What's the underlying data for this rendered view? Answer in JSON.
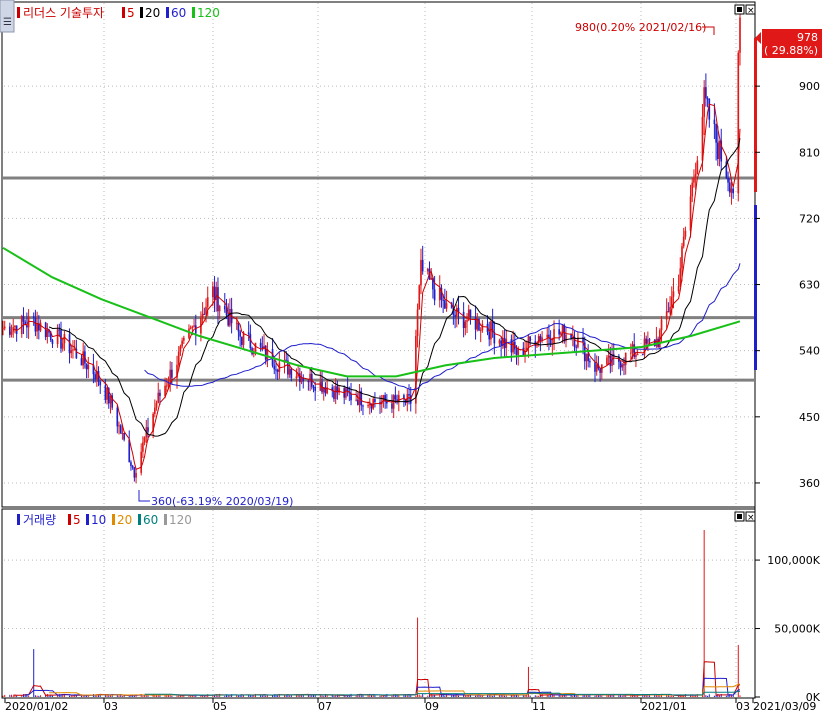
{
  "price_panel": {
    "title": "리더스 기술투자",
    "ma_labels": [
      {
        "label": "5",
        "color": "#cc0000"
      },
      {
        "label": "20",
        "color": "#000000"
      },
      {
        "label": "60",
        "color": "#1f1fcc"
      },
      {
        "label": "120",
        "color": "#18c018"
      }
    ],
    "high_annotation": "980(0.20% 2021/02/16)",
    "low_annotation": "360(-63.19% 2020/03/19)",
    "current_price": "978",
    "current_change": "( 29.88%)",
    "y_ticks": [
      "900",
      "810",
      "720",
      "630",
      "540",
      "450",
      "360"
    ],
    "horizontal_lines": [
      775,
      585,
      500
    ]
  },
  "volume_panel": {
    "title": "거래량",
    "ma_labels": [
      {
        "label": "5",
        "color": "#cc0000"
      },
      {
        "label": "10",
        "color": "#1f1fcc"
      },
      {
        "label": "20",
        "color": "#e08a00"
      },
      {
        "label": "60",
        "color": "#007f7f"
      },
      {
        "label": "120",
        "color": "#999999"
      }
    ],
    "y_ticks": [
      "100,000K",
      "50,000K",
      "0K"
    ]
  },
  "x_axis": {
    "labels": [
      "2020/01/02",
      "03",
      "05",
      "07",
      "09",
      "11",
      "2021/01",
      "03",
      "2021/03/09"
    ]
  },
  "chart_data": {
    "type": "candlestick",
    "title": "리더스 기술투자",
    "x_range": [
      "2020/01/02",
      "2021/03/09"
    ],
    "price_ylim": [
      330,
      990
    ],
    "volume_ylim": [
      0,
      130000
    ],
    "close_series_approx": [
      {
        "date": "2020/01",
        "close": 570
      },
      {
        "date": "2020/01/20",
        "close": 580
      },
      {
        "date": "2020/02/10",
        "close": 545
      },
      {
        "date": "2020/02/25",
        "close": 510
      },
      {
        "date": "2020/03/05",
        "close": 470
      },
      {
        "date": "2020/03/19",
        "close": 375
      },
      {
        "date": "2020/04/01",
        "close": 470
      },
      {
        "date": "2020/04/20",
        "close": 560
      },
      {
        "date": "2020/05/04",
        "close": 620
      },
      {
        "date": "2020/05/20",
        "close": 560
      },
      {
        "date": "2020/06/10",
        "close": 525
      },
      {
        "date": "2020/07/01",
        "close": 500
      },
      {
        "date": "2020/07/20",
        "close": 480
      },
      {
        "date": "2020/08/10",
        "close": 470
      },
      {
        "date": "2020/08/28",
        "close": 470
      },
      {
        "date": "2020/09/03",
        "close": 650
      },
      {
        "date": "2020/09/20",
        "close": 590
      },
      {
        "date": "2020/10/10",
        "close": 575
      },
      {
        "date": "2020/10/30",
        "close": 535
      },
      {
        "date": "2020/11/10",
        "close": 560
      },
      {
        "date": "2020/11/30",
        "close": 565
      },
      {
        "date": "2020/12/15",
        "close": 515
      },
      {
        "date": "2020/12/31",
        "close": 530
      },
      {
        "date": "2021/01/20",
        "close": 555
      },
      {
        "date": "2021/02/01",
        "close": 640
      },
      {
        "date": "2021/02/10",
        "close": 780
      },
      {
        "date": "2021/02/16",
        "close": 880
      },
      {
        "date": "2021/02/25",
        "close": 810
      },
      {
        "date": "2021/03/05",
        "close": 760
      },
      {
        "date": "2021/03/09",
        "close": 978
      }
    ],
    "ma120_approx": [
      680,
      640,
      610,
      585,
      560,
      540,
      520,
      505,
      505,
      520,
      530,
      535,
      540,
      545,
      560,
      580
    ],
    "horizontal_levels": [
      775,
      585,
      500
    ],
    "high": {
      "value": 980,
      "change_pct": 0.2,
      "date": "2021/02/16"
    },
    "low": {
      "value": 360,
      "change_pct": -63.19,
      "date": "2020/03/19"
    },
    "last": {
      "value": 978,
      "change_pct": 29.88
    },
    "volume_spikes": [
      {
        "date": "2020/01/20",
        "volume": 35000
      },
      {
        "date": "2020/09/01",
        "volume": 58000
      },
      {
        "date": "2020/11/05",
        "volume": 22000
      },
      {
        "date": "2021/02/16",
        "volume": 122000
      },
      {
        "date": "2021/03/08",
        "volume": 38000
      }
    ]
  }
}
